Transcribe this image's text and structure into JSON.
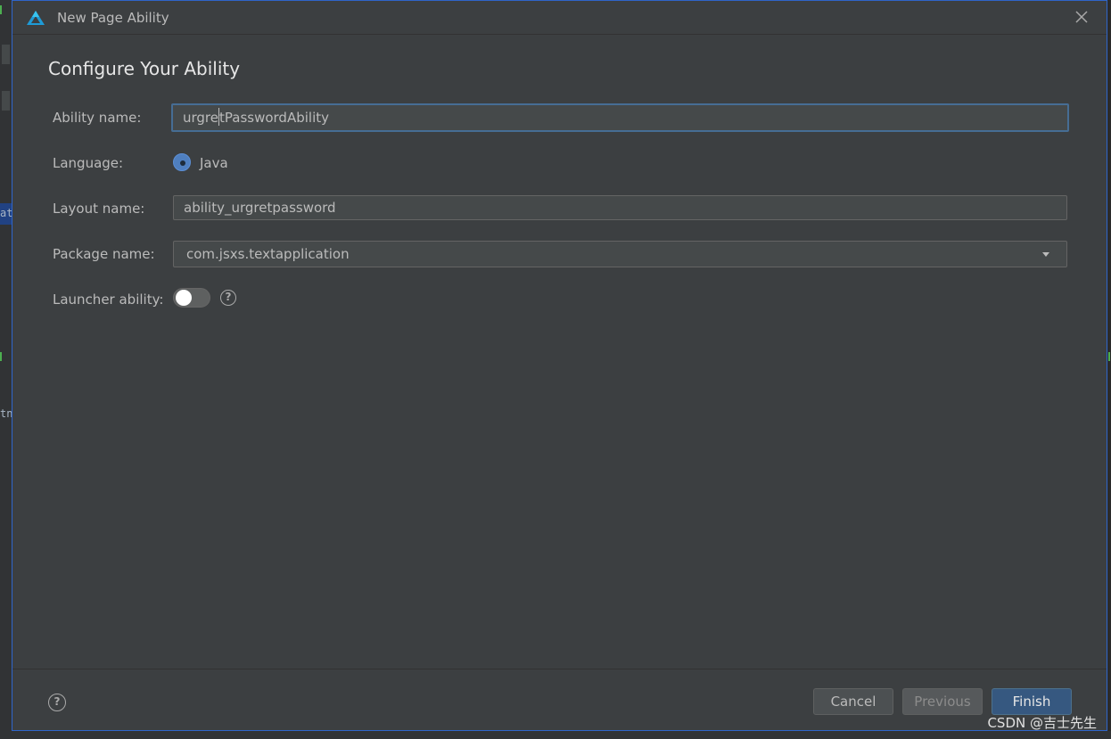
{
  "background": {
    "fragment_1": "at",
    "fragment_2": "tn"
  },
  "dialog": {
    "title": "New Page Ability",
    "heading": "Configure Your Ability"
  },
  "form": {
    "ability_name": {
      "label": "Ability name:",
      "value_before_caret": "urgre",
      "value_after_caret": "tPasswordAbility"
    },
    "language": {
      "label": "Language:",
      "option": "Java",
      "selected": true
    },
    "layout_name": {
      "label": "Layout name:",
      "value": "ability_urgretpassword"
    },
    "package_name": {
      "label": "Package name:",
      "value": "com.jsxs.textapplication"
    },
    "launcher_ability": {
      "label": "Launcher ability:",
      "enabled": false,
      "help": "?"
    }
  },
  "footer": {
    "help": "?",
    "cancel": "Cancel",
    "previous": "Previous",
    "finish": "Finish"
  },
  "watermark": "CSDN @吉士先生",
  "colors": {
    "accent": "#365880",
    "focus_border": "#466d94",
    "dialog_bg": "#3c3f41"
  }
}
